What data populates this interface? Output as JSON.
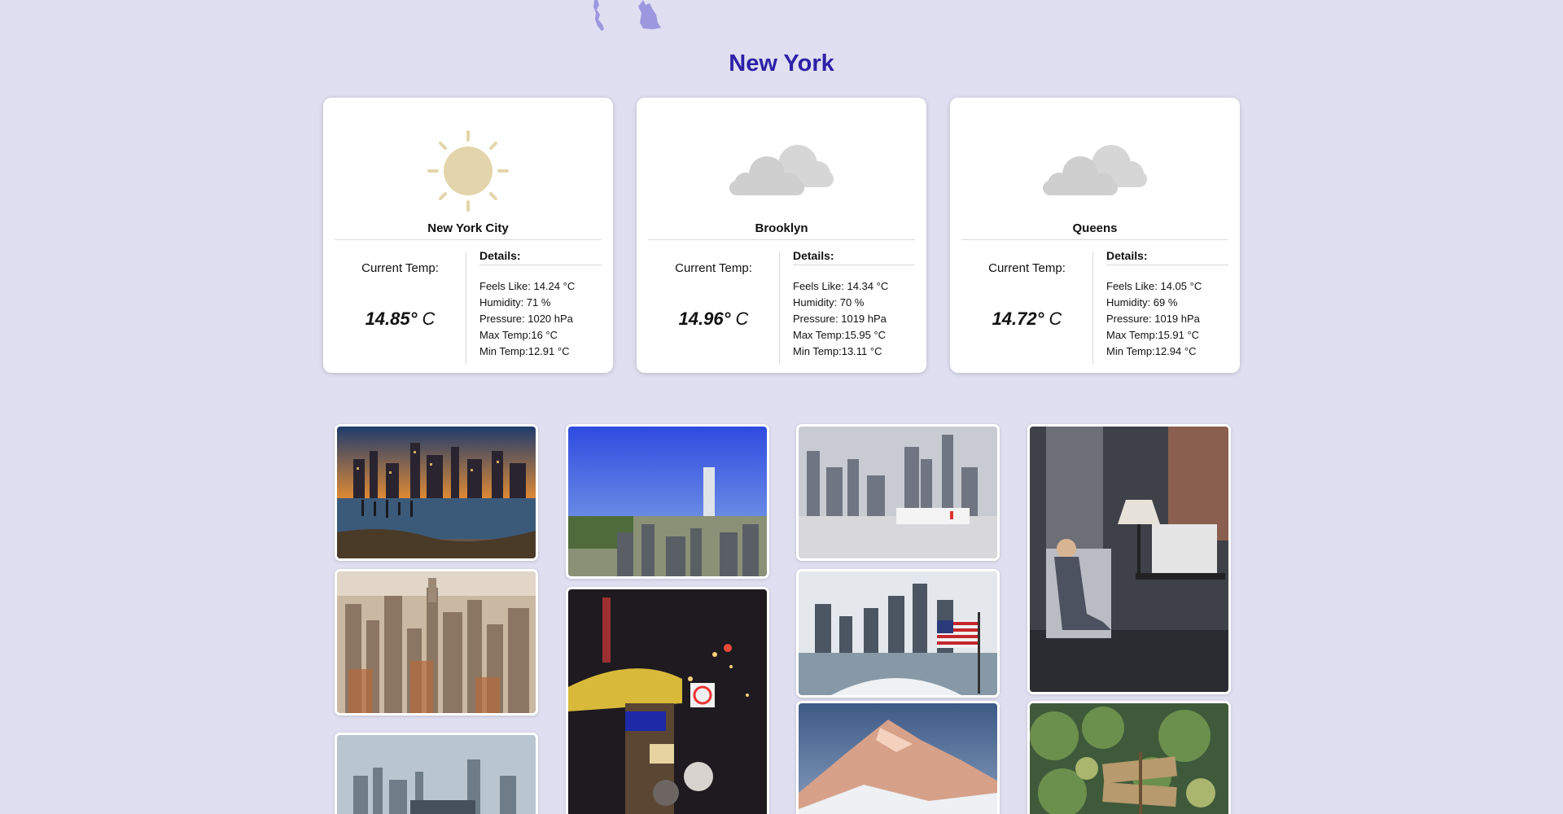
{
  "page": {
    "title": "New York",
    "accent_color": "#2e20a8",
    "background_color": "#dfdff1"
  },
  "cards": [
    {
      "name": "New York City",
      "icon": "sun-icon",
      "current_label": "Current Temp:",
      "temp_value": "14.85°",
      "temp_unit": " C",
      "details_label": "Details:",
      "details": [
        "Feels Like: 14.24 °C",
        "Humidity: 71 %",
        "Pressure: 1020 hPa",
        "Max Temp:16 °C",
        "Min Temp:12.91 °C"
      ]
    },
    {
      "name": "Brooklyn",
      "icon": "cloud-icon",
      "current_label": "Current Temp:",
      "temp_value": "14.96°",
      "temp_unit": " C",
      "details_label": "Details:",
      "details": [
        "Feels Like: 14.34 °C",
        "Humidity: 70 %",
        "Pressure: 1019 hPa",
        "Max Temp:15.95 °C",
        "Min Temp:13.11 °C"
      ]
    },
    {
      "name": "Queens",
      "icon": "cloud-icon",
      "current_label": "Current Temp:",
      "temp_value": "14.72°",
      "temp_unit": " C",
      "details_label": "Details:",
      "details": [
        "Feels Like: 14.05 °C",
        "Humidity: 69 %",
        "Pressure: 1019 hPa",
        "Max Temp:15.91 °C",
        "Min Temp:12.94 °C"
      ]
    }
  ],
  "gallery": {
    "photos": [
      {
        "subject": "night-skyline-pier-photo"
      },
      {
        "subject": "aerial-midtown-photo"
      },
      {
        "subject": "foggy-skyline-photo"
      },
      {
        "subject": "tall-tower-blue-sky-photo"
      },
      {
        "subject": "street-food-cart-night-photo"
      },
      {
        "subject": "harbor-ship-skyline-photo"
      },
      {
        "subject": "ferry-flag-skyline-photo"
      },
      {
        "subject": "snowy-mountain-photo"
      },
      {
        "subject": "woman-living-room-photo"
      },
      {
        "subject": "garden-no-entry-sign-photo"
      }
    ]
  }
}
